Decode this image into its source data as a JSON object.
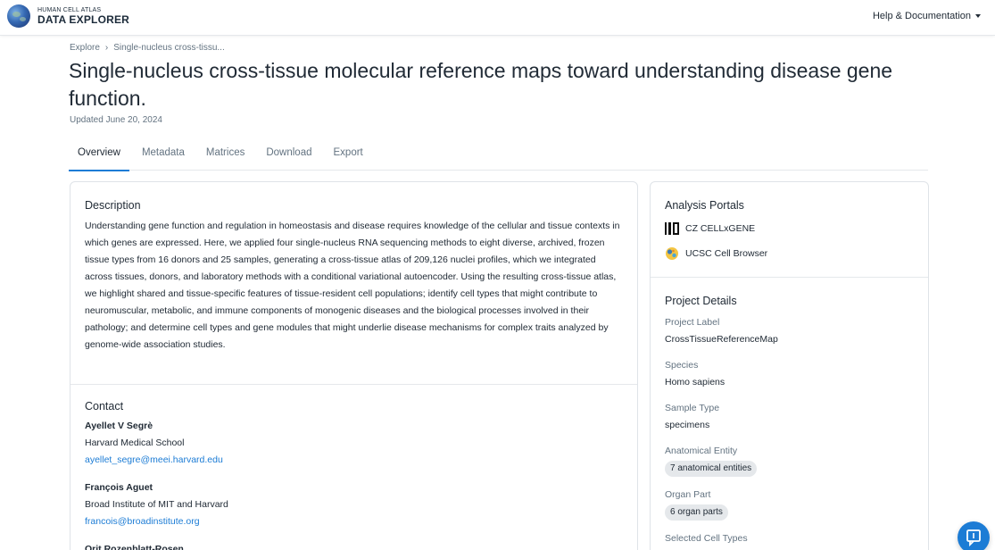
{
  "header": {
    "logo_small": "HUMAN CELL ATLAS",
    "logo_big": "DATA EXPLORER",
    "help_label": "Help & Documentation"
  },
  "breadcrumb": {
    "root": "Explore",
    "current": "Single-nucleus cross-tissu..."
  },
  "page": {
    "title": "Single-nucleus cross-tissue molecular reference maps toward understanding disease gene function.",
    "updated": "Updated June 20, 2024"
  },
  "tabs": [
    {
      "label": "Overview",
      "active": true
    },
    {
      "label": "Metadata",
      "active": false
    },
    {
      "label": "Matrices",
      "active": false
    },
    {
      "label": "Download",
      "active": false
    },
    {
      "label": "Export",
      "active": false
    }
  ],
  "description": {
    "heading": "Description",
    "text": "Understanding gene function and regulation in homeostasis and disease requires knowledge of the cellular and tissue contexts in which genes are expressed. Here, we applied four single-nucleus RNA sequencing methods to eight diverse, archived, frozen tissue types from 16 donors and 25 samples, generating a cross-tissue atlas of 209,126 nuclei profiles, which we integrated across tissues, donors, and laboratory methods with a conditional variational autoencoder. Using the resulting cross-tissue atlas, we highlight shared and tissue-specific features of tissue-resident cell populations; identify cell types that might contribute to neuromuscular, metabolic, and immune components of monogenic diseases and the biological processes involved in their pathology; and determine cell types and gene modules that might underlie disease mechanisms for complex traits analyzed by genome-wide association studies."
  },
  "contact": {
    "heading": "Contact",
    "people": [
      {
        "name": "Ayellet V Segrè",
        "org": "Harvard Medical School",
        "email": "ayellet_segre@meei.harvard.edu"
      },
      {
        "name": "François Aguet",
        "org": "Broad Institute of MIT and Harvard",
        "email": "francois@broadinstitute.org"
      },
      {
        "name": "Orit Rozenblatt-Rosen",
        "org": "",
        "email": ""
      }
    ]
  },
  "portals": {
    "heading": "Analysis Portals",
    "items": [
      {
        "label": "CZ CELLxGENE",
        "icon": "cellxgene-icon"
      },
      {
        "label": "UCSC Cell Browser",
        "icon": "ucsc-cell-browser-icon"
      }
    ]
  },
  "details": {
    "heading": "Project Details",
    "project_label_label": "Project Label",
    "project_label_value": "CrossTissueReferenceMap",
    "species_label": "Species",
    "species_value": "Homo sapiens",
    "sample_type_label": "Sample Type",
    "sample_type_value": "specimens",
    "anatomical_label": "Anatomical Entity",
    "anatomical_value": "7 anatomical entities",
    "organ_part_label": "Organ Part",
    "organ_part_value": "6 organ parts",
    "cell_types_label": "Selected Cell Types"
  },
  "colors": {
    "accent": "#1c7cd5",
    "text": "#212b36",
    "muted": "#637381",
    "border": "#dfe3e8"
  },
  "icons": {
    "help_caret": "caret-down-icon",
    "breadcrumb_sep": "chevron-right-icon",
    "fab": "support-chat-icon"
  }
}
